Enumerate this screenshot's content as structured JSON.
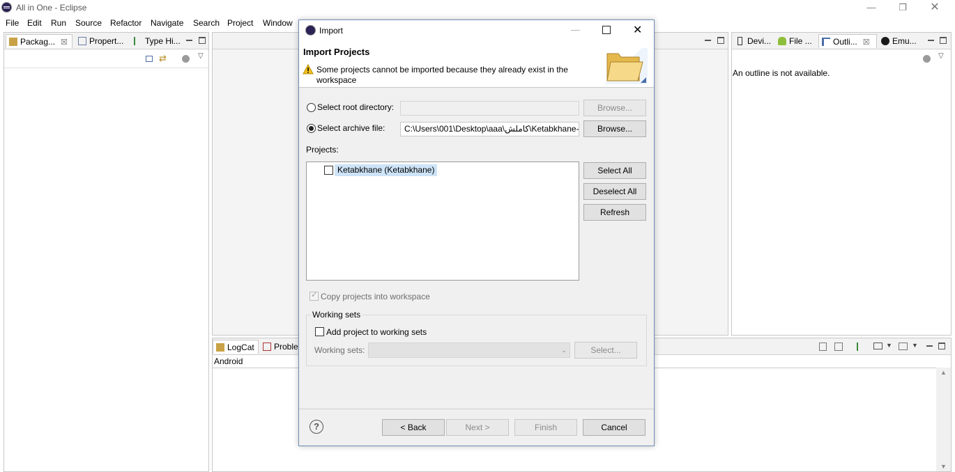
{
  "window": {
    "title": "All in One - Eclipse"
  },
  "menu": [
    "File",
    "Edit",
    "Run",
    "Source",
    "Refactor",
    "Navigate",
    "Search",
    "Project",
    "Window"
  ],
  "left_panel": {
    "tabs": [
      {
        "label": "Packag...",
        "icon": "package-explorer-icon"
      },
      {
        "label": "Propert...",
        "icon": "properties-icon"
      },
      {
        "label": "Type Hi...",
        "icon": "type-hierarchy-icon"
      }
    ]
  },
  "right_panel": {
    "tabs": [
      {
        "label": "Devi...",
        "icon": "devices-icon"
      },
      {
        "label": "File ...",
        "icon": "android-icon"
      },
      {
        "label": "Outli...",
        "icon": "outline-icon"
      },
      {
        "label": "Emu...",
        "icon": "emulator-icon"
      }
    ],
    "message": "An outline is not available."
  },
  "bottom_panel": {
    "tabs": [
      {
        "label": "LogCat",
        "icon": "logcat-icon"
      },
      {
        "label": "Proble",
        "icon": "problems-icon"
      }
    ],
    "subtitle": "Android"
  },
  "dialog": {
    "title": "Import",
    "header_title": "Import Projects",
    "warning": "Some projects cannot be imported because they already exist in the workspace",
    "select_root_label": "Select root directory:",
    "select_archive_label": "Select archive file:",
    "archive_path": "C:\\Users\\001\\Desktop\\aaa\\کاملش\\Ketabkhane-",
    "browse_label": "Browse...",
    "projects_label": "Projects:",
    "projects": [
      "Ketabkhane (Ketabkhane)"
    ],
    "select_all": "Select All",
    "deselect_all": "Deselect All",
    "refresh": "Refresh",
    "copy_projects": "Copy projects into workspace",
    "working_sets_group": "Working sets",
    "add_to_working_sets": "Add project to working sets",
    "working_sets_label": "Working sets:",
    "select_ws": "Select...",
    "back": "< Back",
    "next": "Next >",
    "finish": "Finish",
    "cancel": "Cancel"
  }
}
